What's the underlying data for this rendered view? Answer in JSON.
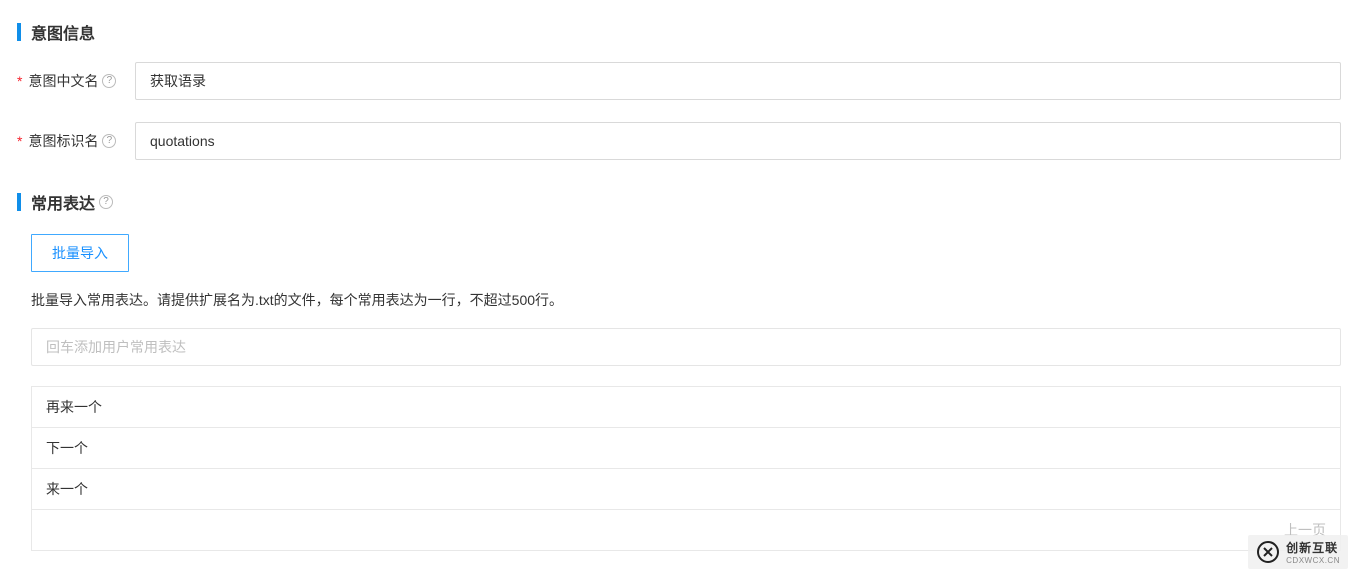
{
  "section1": {
    "title": "意图信息",
    "fields": {
      "chinese_name": {
        "label": "意图中文名",
        "value": "获取语录"
      },
      "identifier": {
        "label": "意图标识名",
        "value": "quotations"
      }
    }
  },
  "section2": {
    "title": "常用表达",
    "import_button": "批量导入",
    "import_hint": "批量导入常用表达。请提供扩展名为.txt的文件，每个常用表达为一行，不超过500行。",
    "input_placeholder": "回车添加用户常用表达",
    "expressions": [
      "再来一个",
      "下一个",
      "来一个"
    ],
    "pager_prev": "上一页"
  },
  "watermark": {
    "main": "创新互联",
    "sub": "CDXWCX.CN"
  }
}
